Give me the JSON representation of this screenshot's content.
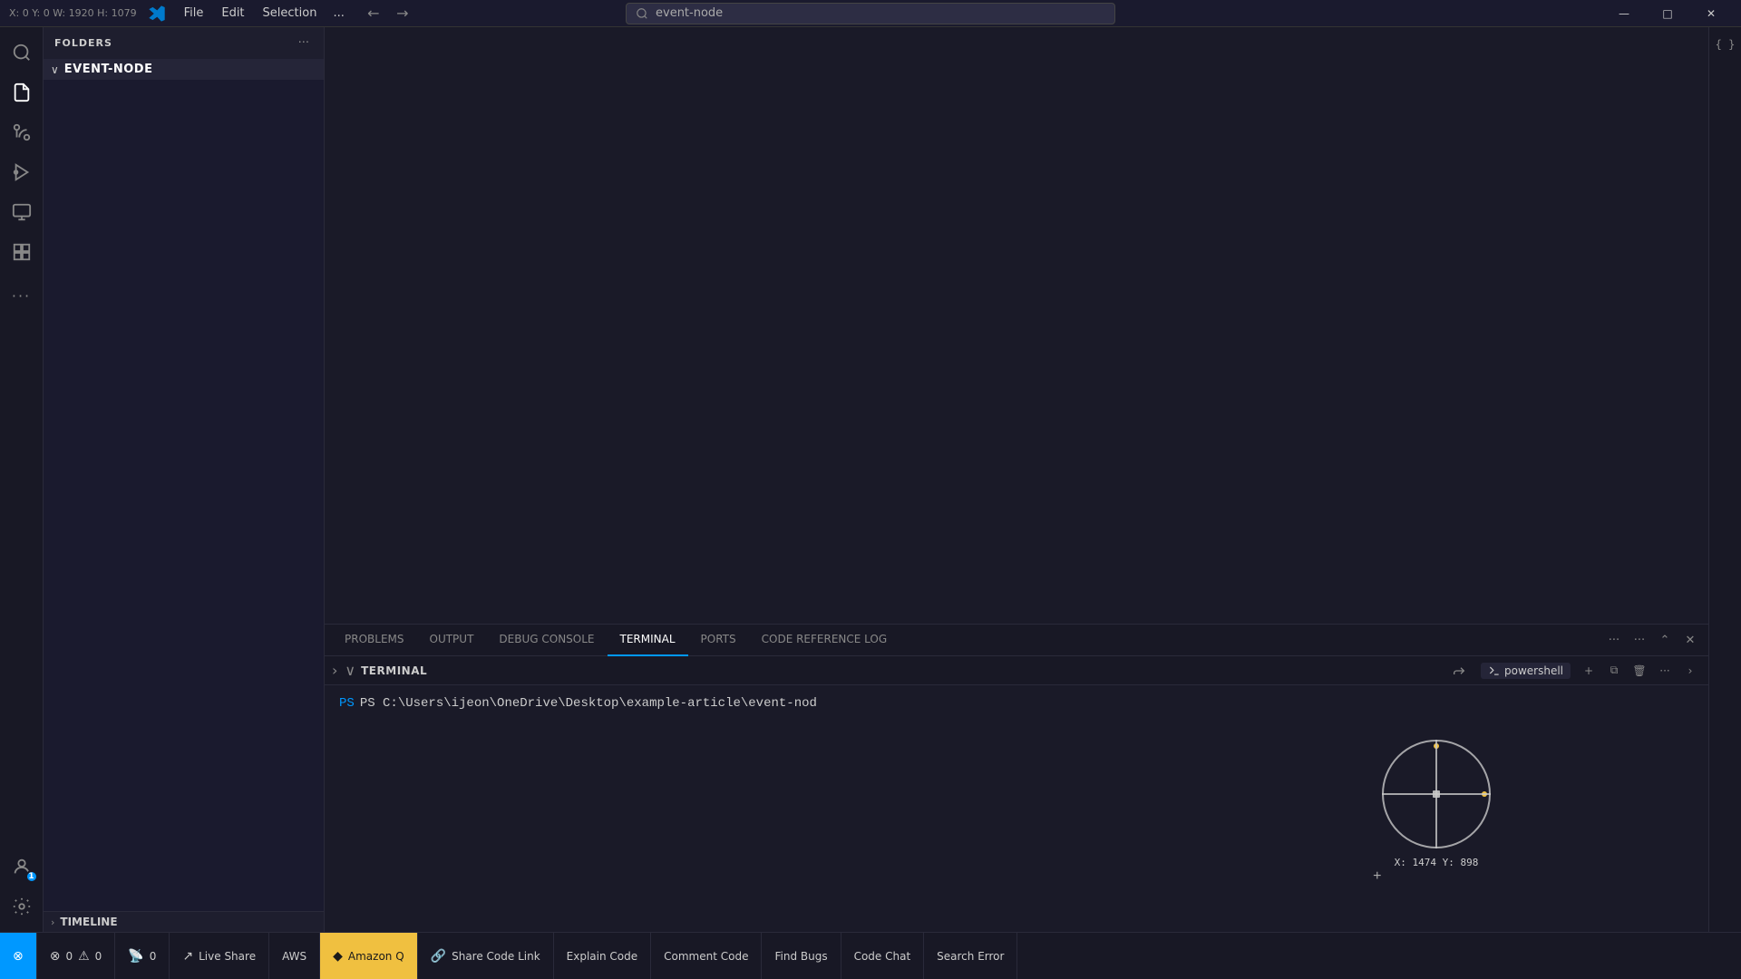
{
  "titlebar": {
    "coords": "X: 0 Y: 0 W: 1920 H: 1079",
    "menu": {
      "file": "File",
      "edit": "Edit",
      "selection": "Selection",
      "more": "..."
    },
    "search_placeholder": "event-node",
    "nav_back": "←",
    "nav_forward": "→",
    "win_minimize": "—",
    "win_maximize": "□",
    "win_close": "✕"
  },
  "sidebar": {
    "folders_label": "FOLDERS",
    "folders_more": "...",
    "folder_name": "EVENT-NODE",
    "timeline_label": "TIMELINE"
  },
  "panel": {
    "tabs": [
      {
        "label": "PROBLEMS",
        "active": false
      },
      {
        "label": "OUTPUT",
        "active": false
      },
      {
        "label": "DEBUG CONSOLE",
        "active": false
      },
      {
        "label": "TERMINAL",
        "active": true
      },
      {
        "label": "PORTS",
        "active": false
      },
      {
        "label": "CODE REFERENCE LOG",
        "active": false
      }
    ],
    "more": "...",
    "terminal": {
      "label": "TERMINAL",
      "shell": "powershell",
      "prompt": "PS C:\\Users\\ijeon\\OneDrive\\Desktop\\example-article\\event-nod"
    },
    "cursor_coords": "X: 1474 Y: 898"
  },
  "statusbar": {
    "items": [
      {
        "id": "remote",
        "icon": "⊗",
        "text": "",
        "style": "blue-bg"
      },
      {
        "id": "errors",
        "icon": "⊗",
        "count": "0",
        "warnings_icon": "⚠",
        "warnings": "0",
        "text": "0  ⚠ 0"
      },
      {
        "id": "broadcast",
        "icon": "📡",
        "count": "0",
        "text": "0"
      },
      {
        "id": "liveshare",
        "icon": "↗",
        "text": "Live Share"
      },
      {
        "id": "aws",
        "icon": "",
        "text": "AWS"
      },
      {
        "id": "amazonq",
        "icon": "◆",
        "text": "Amazon Q",
        "style": "yellow-bg"
      },
      {
        "id": "sharecodelink",
        "icon": "🔗",
        "text": "Share Code Link"
      },
      {
        "id": "explaincode",
        "icon": "",
        "text": "Explain Code"
      },
      {
        "id": "commentcode",
        "icon": "",
        "text": "Comment Code"
      },
      {
        "id": "findbugs",
        "icon": "",
        "text": "Find Bugs"
      },
      {
        "id": "codechat",
        "icon": "",
        "text": "Code Chat"
      },
      {
        "id": "searcherror",
        "icon": "",
        "text": "Search Error"
      }
    ]
  }
}
